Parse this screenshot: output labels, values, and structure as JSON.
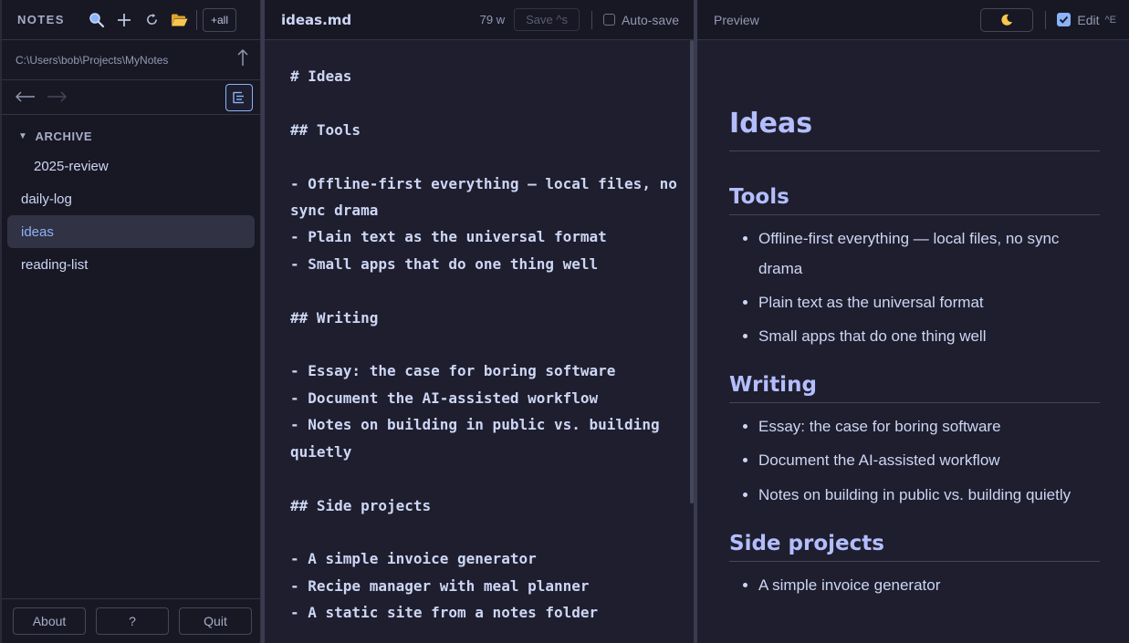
{
  "sidebar": {
    "title": "NOTES",
    "all_label": "+all",
    "path": "C:\\Users\\bob\\Projects\\MyNotes",
    "folder": {
      "name": "ARCHIVE",
      "children": [
        "2025-review"
      ]
    },
    "files": [
      "daily-log",
      "ideas",
      "reading-list"
    ],
    "active_file": "ideas",
    "footer": {
      "about": "About",
      "help": "?",
      "quit": "Quit"
    }
  },
  "editor": {
    "file_name": "ideas.md",
    "word_count": "79 w",
    "save_label": "Save ^s",
    "autosave_label": "Auto-save",
    "autosave_checked": false,
    "content": "# Ideas\n\n## Tools\n\n- Offline-first everything — local files, no sync drama\n- Plain text as the universal format\n- Small apps that do one thing well\n\n## Writing\n\n- Essay: the case for boring software\n- Document the AI-assisted workflow\n- Notes on building in public vs. building quietly\n\n## Side projects\n\n- A simple invoice generator\n- Recipe manager with meal planner\n- A static site from a notes folder"
  },
  "preview": {
    "title": "Preview",
    "theme_icon": "moon-icon",
    "edit_label": "Edit",
    "edit_shortcut": "^E",
    "edit_checked": true,
    "doc": {
      "h1": "Ideas",
      "sections": [
        {
          "heading": "Tools",
          "items": [
            "Offline-first everything — local files, no sync drama",
            "Plain text as the universal format",
            "Small apps that do one thing well"
          ]
        },
        {
          "heading": "Writing",
          "items": [
            "Essay: the case for boring software",
            "Document the AI-assisted workflow",
            "Notes on building in public vs. building quietly"
          ]
        },
        {
          "heading": "Side projects",
          "items": [
            "A simple invoice generator"
          ]
        }
      ]
    }
  },
  "colors": {
    "accent": "#89b4fa",
    "heading": "#b4befe",
    "background": "#1e1e2e",
    "sidebar": "#181825"
  }
}
